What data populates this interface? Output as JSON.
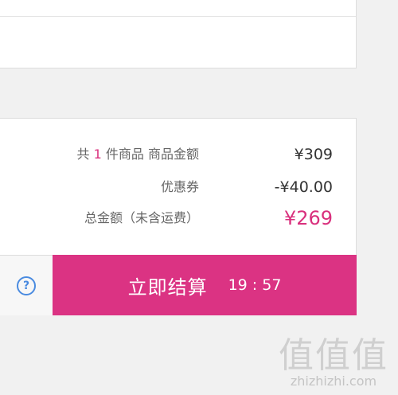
{
  "summary": {
    "goods_count_prefix": "共",
    "goods_count": "1",
    "goods_count_suffix": "件商品  商品金额",
    "goods_amount": "¥309",
    "coupon_label": "优惠券",
    "coupon_amount": "-¥40.00",
    "total_label": "总金额（未含运费）",
    "total_amount": "¥269"
  },
  "bottom_bar": {
    "help_icon_glyph": "?",
    "checkout_label": "立即结算",
    "countdown": "19 : 57"
  },
  "watermark": {
    "mark": "值值值",
    "text": "zhizhizhi.com"
  },
  "colors": {
    "accent": "#db3383",
    "help_icon": "#4a8be0"
  }
}
